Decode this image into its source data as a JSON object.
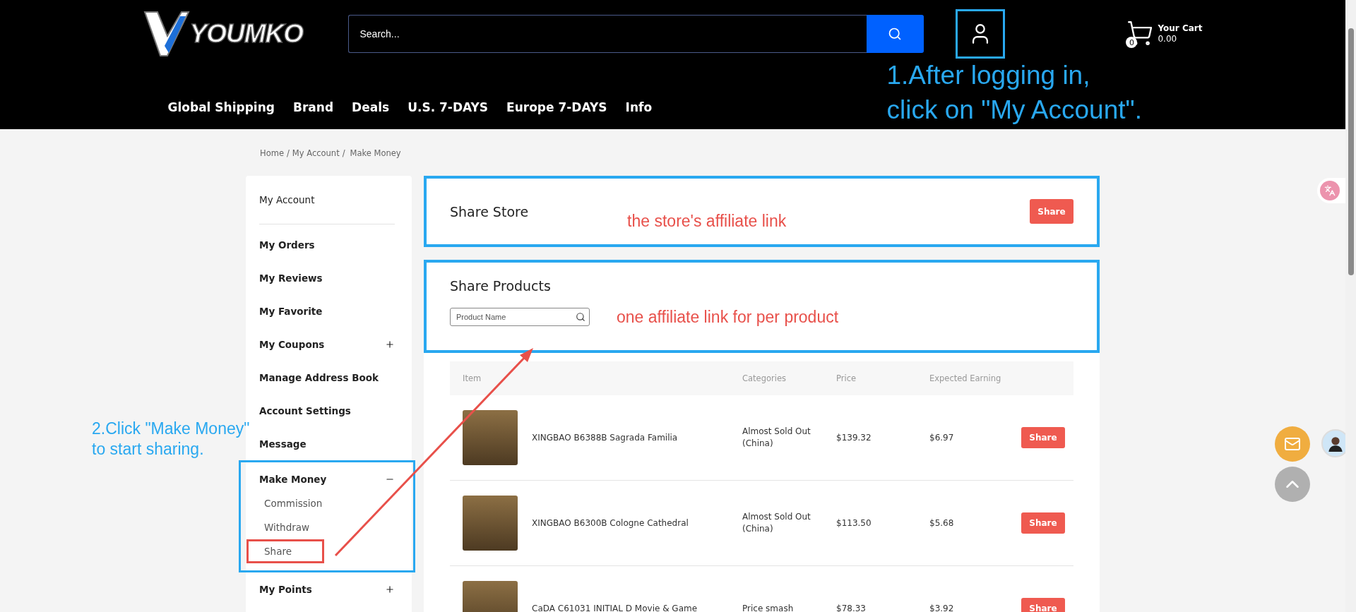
{
  "header": {
    "logo": "YOUMKO",
    "search": {
      "placeholder": "Search..."
    },
    "account": {
      "highlighted": true
    },
    "cart": {
      "count": "0",
      "label": "Your Cart",
      "total": "0.00"
    },
    "nav": [
      "Global Shipping",
      "Brand",
      "Deals",
      "U.S. 7-DAYS",
      "Europe 7-DAYS",
      "Info"
    ],
    "annotation": [
      "1.After logging in,",
      "click on \"My Account\"."
    ]
  },
  "breadcrumb": [
    {
      "kind": "link",
      "text": "Home"
    },
    {
      "kind": "separator",
      "text": "/"
    },
    {
      "kind": "link",
      "text": "My Account"
    },
    {
      "kind": "separator",
      "text": "/"
    },
    {
      "kind": "current",
      "text": "Make Money"
    }
  ],
  "sidebar": {
    "annotation": [
      "2.Click \"Make Money\"",
      "to start sharing."
    ],
    "items": [
      {
        "label": "My Account",
        "kind": "heading"
      },
      {
        "label": "My Orders",
        "kind": "link"
      },
      {
        "label": "My Reviews",
        "kind": "link"
      },
      {
        "label": "My Favorite",
        "kind": "link"
      },
      {
        "label": "My Coupons",
        "kind": "group",
        "expanded": false
      },
      {
        "label": "Manage Address Book",
        "kind": "link"
      },
      {
        "label": "Account Settings",
        "kind": "link"
      },
      {
        "label": "Message",
        "kind": "link"
      },
      {
        "label": "Make Money",
        "kind": "group",
        "expanded": true,
        "highlighted": true,
        "children": [
          {
            "label": "Commission",
            "highlighted": false
          },
          {
            "label": "Withdraw",
            "highlighted": false
          },
          {
            "label": "Share",
            "highlighted": true
          }
        ]
      },
      {
        "label": "My Points",
        "kind": "group",
        "expanded": false
      }
    ]
  },
  "share_store": {
    "title": "Share Store",
    "annotation": "the store's affiliate link",
    "button": "Share",
    "highlighted": true
  },
  "share_products": {
    "title": "Share Products",
    "search": {
      "placeholder": "Product Name"
    },
    "annotation": "one affiliate link for per product",
    "highlighted": true,
    "table": {
      "columns": [
        "Item",
        "Categories",
        "Price",
        "Expected Earning"
      ],
      "rows": [
        {
          "item": "XINGBAO B6388B Sagrada Familia",
          "category": "Almost Sold Out (China)",
          "price": "$139.32",
          "earning": "$6.97",
          "button": "Share"
        },
        {
          "item": "XINGBAO B6300B Cologne Cathedral",
          "category": "Almost Sold Out (China)",
          "price": "$113.50",
          "earning": "$5.68",
          "button": "Share"
        },
        {
          "item": "CaDA C61031 INITIAL D Movie & Game",
          "category": "Price smash",
          "price": "$78.33",
          "earning": "$3.92",
          "button": "Share"
        }
      ]
    }
  }
}
